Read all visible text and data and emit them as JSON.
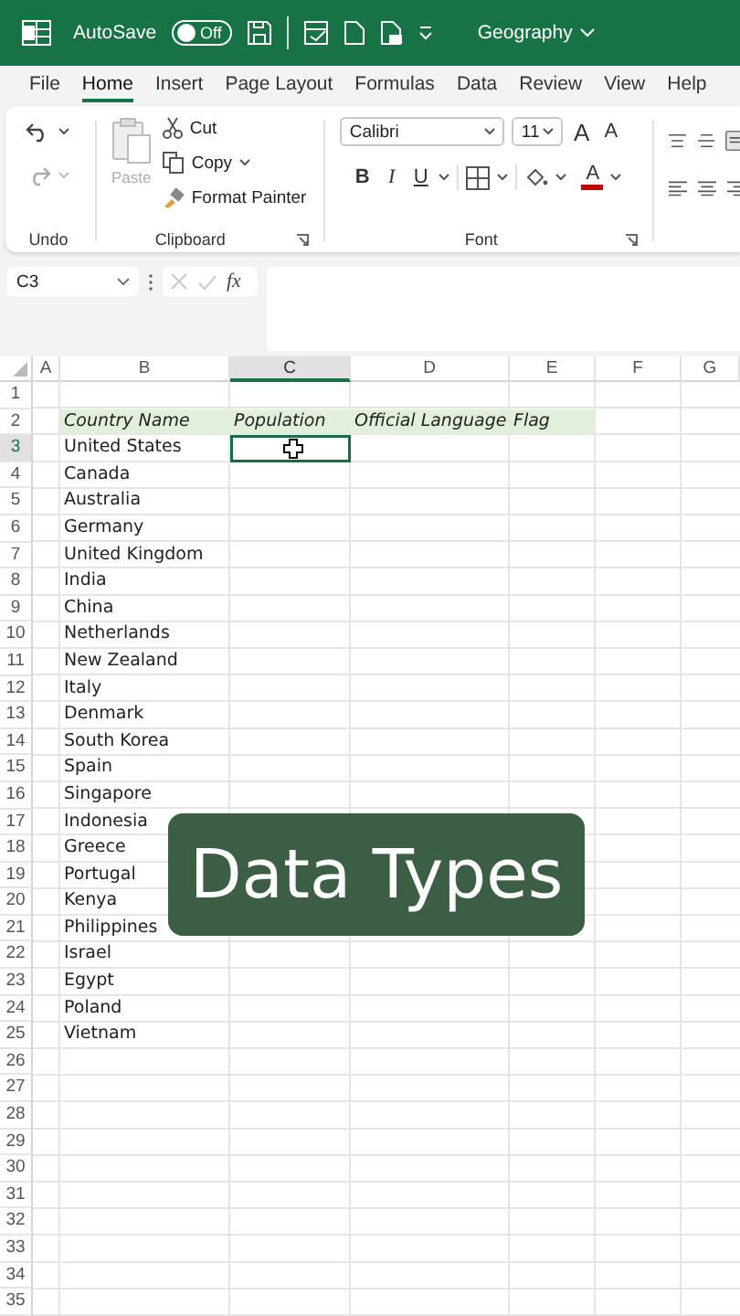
{
  "title_bar": {
    "autosave_label": "AutoSave",
    "autosave": {
      "label": "Off",
      "on": false
    },
    "document_title": "Geography"
  },
  "menu_tabs": [
    {
      "label": "File",
      "selected": false
    },
    {
      "label": "Home",
      "selected": true
    },
    {
      "label": "Insert",
      "selected": false
    },
    {
      "label": "Page Layout",
      "selected": false
    },
    {
      "label": "Formulas",
      "selected": false
    },
    {
      "label": "Data",
      "selected": false
    },
    {
      "label": "Review",
      "selected": false
    },
    {
      "label": "View",
      "selected": false
    },
    {
      "label": "Help",
      "selected": false
    }
  ],
  "ribbon": {
    "undo": {
      "label": "Undo"
    },
    "clipboard": {
      "paste": "Paste",
      "cut": "Cut",
      "copy": "Copy",
      "format_painter": "Format Painter",
      "label": "Clipboard"
    },
    "font": {
      "name": "Calibri",
      "size": "11",
      "grow": "A",
      "shrink": "A",
      "bold": "B",
      "italic": "I",
      "underline": "U",
      "font_color_button": "A",
      "label": "Font"
    }
  },
  "formula_bar": {
    "name_box": "C3",
    "fx": "fx"
  },
  "sheet": {
    "columns": [
      {
        "label": "A",
        "selected": false
      },
      {
        "label": "B",
        "selected": false
      },
      {
        "label": "C",
        "selected": true
      },
      {
        "label": "D",
        "selected": false
      },
      {
        "label": "E",
        "selected": false
      },
      {
        "label": "F",
        "selected": false
      },
      {
        "label": "G",
        "selected": false
      }
    ],
    "rows": [
      {
        "number": "1",
        "kind": "blank",
        "selected": false
      },
      {
        "number": "2",
        "kind": "header",
        "selected": false,
        "cells": [
          "Country Name",
          "Population",
          "Official Language",
          "Flag"
        ]
      },
      {
        "number": "3",
        "kind": "data",
        "selected": true,
        "cells": [
          "United States"
        ]
      },
      {
        "number": "4",
        "kind": "data",
        "selected": false,
        "cells": [
          "Canada"
        ]
      },
      {
        "number": "5",
        "kind": "data",
        "selected": false,
        "cells": [
          "Australia"
        ]
      },
      {
        "number": "6",
        "kind": "data",
        "selected": false,
        "cells": [
          "Germany"
        ]
      },
      {
        "number": "7",
        "kind": "data",
        "selected": false,
        "cells": [
          "United Kingdom"
        ]
      },
      {
        "number": "8",
        "kind": "data",
        "selected": false,
        "cells": [
          "India"
        ]
      },
      {
        "number": "9",
        "kind": "data",
        "selected": false,
        "cells": [
          "China"
        ]
      },
      {
        "number": "10",
        "kind": "data",
        "selected": false,
        "cells": [
          "Netherlands"
        ]
      },
      {
        "number": "11",
        "kind": "data",
        "selected": false,
        "cells": [
          "New Zealand"
        ]
      },
      {
        "number": "12",
        "kind": "data",
        "selected": false,
        "cells": [
          "Italy"
        ]
      },
      {
        "number": "13",
        "kind": "data",
        "selected": false,
        "cells": [
          "Denmark"
        ]
      },
      {
        "number": "14",
        "kind": "data",
        "selected": false,
        "cells": [
          "South Korea"
        ]
      },
      {
        "number": "15",
        "kind": "data",
        "selected": false,
        "cells": [
          "Spain"
        ]
      },
      {
        "number": "16",
        "kind": "data",
        "selected": false,
        "cells": [
          "Singapore"
        ]
      },
      {
        "number": "17",
        "kind": "data",
        "selected": false,
        "cells": [
          "Indonesia"
        ]
      },
      {
        "number": "18",
        "kind": "data",
        "selected": false,
        "cells": [
          "Greece"
        ]
      },
      {
        "number": "19",
        "kind": "data",
        "selected": false,
        "cells": [
          "Portugal"
        ]
      },
      {
        "number": "20",
        "kind": "data",
        "selected": false,
        "cells": [
          "Kenya"
        ]
      },
      {
        "number": "21",
        "kind": "data",
        "selected": false,
        "cells": [
          "Philippines"
        ]
      },
      {
        "number": "22",
        "kind": "data",
        "selected": false,
        "cells": [
          "Israel"
        ]
      },
      {
        "number": "23",
        "kind": "data",
        "selected": false,
        "cells": [
          "Egypt"
        ]
      },
      {
        "number": "24",
        "kind": "data",
        "selected": false,
        "cells": [
          "Poland"
        ]
      },
      {
        "number": "25",
        "kind": "data",
        "selected": false,
        "cells": [
          "Vietnam"
        ]
      },
      {
        "number": "26",
        "kind": "blank",
        "selected": false
      },
      {
        "number": "27",
        "kind": "blank",
        "selected": false
      },
      {
        "number": "28",
        "kind": "blank",
        "selected": false
      },
      {
        "number": "29",
        "kind": "blank",
        "selected": false
      },
      {
        "number": "30",
        "kind": "blank",
        "selected": false
      },
      {
        "number": "31",
        "kind": "blank",
        "selected": false
      },
      {
        "number": "32",
        "kind": "blank",
        "selected": false
      },
      {
        "number": "33",
        "kind": "blank",
        "selected": false
      },
      {
        "number": "34",
        "kind": "blank",
        "selected": false
      },
      {
        "number": "35",
        "kind": "blank",
        "selected": false
      }
    ]
  },
  "caption": "Data Types"
}
